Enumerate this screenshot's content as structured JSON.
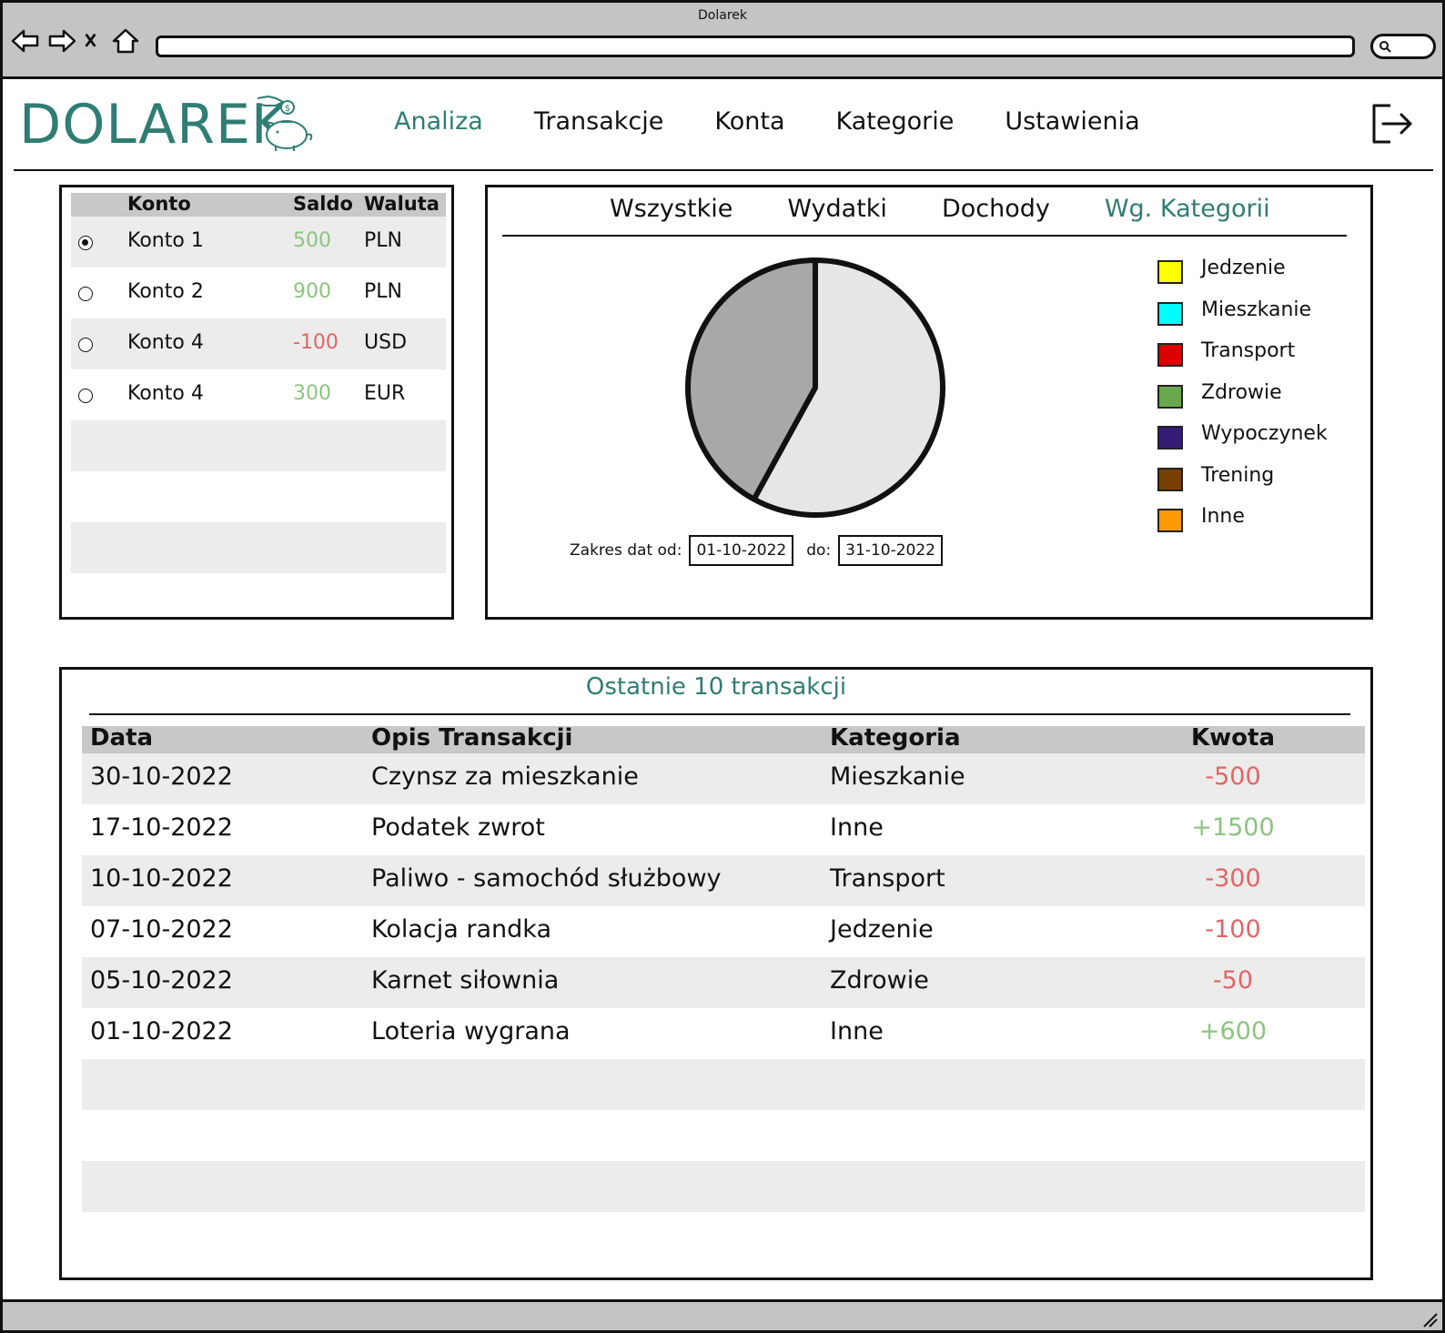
{
  "window": {
    "title": "Dolarek",
    "nav_icons": [
      "back-icon",
      "forward-icon",
      "close-icon",
      "home-icon"
    ],
    "search_icon": "search-icon"
  },
  "app": {
    "logo_text": "DOLAREK",
    "logo_art": "piggy-bank-coin-icon",
    "nav": [
      {
        "label": "Analiza",
        "active": true
      },
      {
        "label": "Transakcje",
        "active": false
      },
      {
        "label": "Konta",
        "active": false
      },
      {
        "label": "Kategorie",
        "active": false
      },
      {
        "label": "Ustawienia",
        "active": false
      }
    ],
    "logout_icon": "logout-icon",
    "accent_color": "#2f7d73"
  },
  "accounts": {
    "headers": {
      "name": "Konto",
      "saldo": "Saldo",
      "currency": "Waluta"
    },
    "rows": [
      {
        "name": "Konto 1",
        "saldo": "500",
        "currency": "PLN",
        "selected": true,
        "sign": "pos"
      },
      {
        "name": "Konto 2",
        "saldo": "900",
        "currency": "PLN",
        "selected": false,
        "sign": "pos"
      },
      {
        "name": "Konto 4",
        "saldo": "-100",
        "currency": "USD",
        "selected": false,
        "sign": "neg"
      },
      {
        "name": "Konto 4",
        "saldo": "300",
        "currency": "EUR",
        "selected": false,
        "sign": "pos"
      }
    ]
  },
  "chart": {
    "tabs": [
      {
        "label": "Wszystkie",
        "active": false
      },
      {
        "label": "Wydatki",
        "active": false
      },
      {
        "label": "Dochody",
        "active": false
      },
      {
        "label": "Wg. Kategorii",
        "active": true
      }
    ],
    "legend": [
      {
        "label": "Jedzenie",
        "color": "#ffff00"
      },
      {
        "label": "Mieszkanie",
        "color": "#00ffff"
      },
      {
        "label": "Transport",
        "color": "#dd0000"
      },
      {
        "label": "Zdrowie",
        "color": "#6aa84f"
      },
      {
        "label": "Wypoczynek",
        "color": "#351c75"
      },
      {
        "label": "Trening",
        "color": "#783f04"
      },
      {
        "label": "Inne",
        "color": "#ff9900"
      }
    ],
    "date_from_label": "Zakres dat od:",
    "date_from": "01-10-2022",
    "date_to_label": "do:",
    "date_to": "31-10-2022"
  },
  "chart_data": {
    "type": "pie",
    "slices": [
      {
        "value": 58,
        "color": "#e6e6e6"
      },
      {
        "value": 42,
        "color": "#a8a8a8"
      }
    ]
  },
  "transactions": {
    "title": "Ostatnie 10 transakcji",
    "headers": {
      "date": "Data",
      "desc": "Opis Transakcji",
      "cat": "Kategoria",
      "amount": "Kwota"
    },
    "rows": [
      {
        "date": "30-10-2022",
        "desc": "Czynsz za mieszkanie",
        "cat": "Mieszkanie",
        "amount": "-500",
        "sign": "neg"
      },
      {
        "date": "17-10-2022",
        "desc": "Podatek zwrot",
        "cat": "Inne",
        "amount": "+1500",
        "sign": "pos"
      },
      {
        "date": "10-10-2022",
        "desc": "Paliwo - samochód służbowy",
        "cat": "Transport",
        "amount": "-300",
        "sign": "neg"
      },
      {
        "date": "07-10-2022",
        "desc": "Kolacja randka",
        "cat": "Jedzenie",
        "amount": "-100",
        "sign": "neg"
      },
      {
        "date": "05-10-2022",
        "desc": "Karnet siłownia",
        "cat": "Zdrowie",
        "amount": "-50",
        "sign": "neg"
      },
      {
        "date": "01-10-2022",
        "desc": "Loteria wygrana",
        "cat": "Inne",
        "amount": "+600",
        "sign": "pos"
      }
    ]
  }
}
